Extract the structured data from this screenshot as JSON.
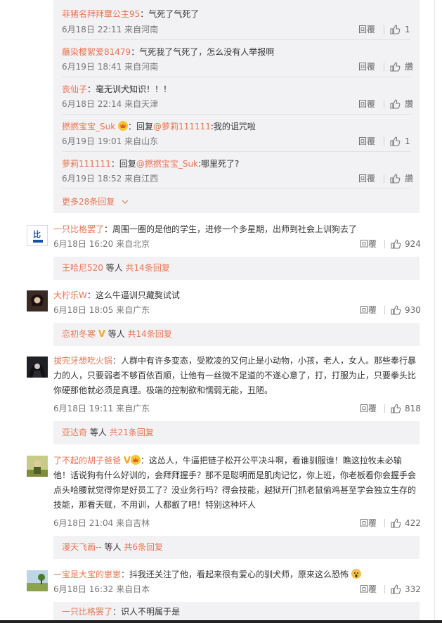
{
  "colors": {
    "accent": "#eb7350",
    "bg_reply": "#f2f2f5",
    "gold": "#f6a623"
  },
  "action_labels": {
    "reply": "回覆"
  },
  "top_replies": [
    {
      "user": "菲猪名拜拜覃公主95",
      "text": "：气死了气死了",
      "time": "6月18日 22:11 来自河南",
      "likes": "1"
    },
    {
      "user": "蘸染樱絮爱81479",
      "text": "：气死我了气死了，怎么没有人举报啊",
      "time": "6月19日 18:41 来自河南",
      "likes": "讚"
    },
    {
      "user": "丧仙子",
      "text": "：毫无训犬知识！！！",
      "time": "6月18日 22:14 来自天津",
      "likes": "讚"
    },
    {
      "user": "撚撚宝宝_Suk",
      "text": "：回复",
      "mention": "@萝莉111111",
      "text2": ":我的诅咒啦",
      "time": "6月19日 19:01 来自山东",
      "likes": "1"
    },
    {
      "user": "萝莉111111",
      "text": "：回复",
      "mention": "@撚撚宝宝_Suk",
      "text2": ":哪里死了?",
      "time": "6月19日 18:52 来自江西",
      "likes": "讚"
    }
  ],
  "more_replies": "更多28条回复",
  "comments": [
    {
      "user": "一只比格罢了",
      "text": "：周围一圈的是他的学生，进修一个多星期，出师到社会上训狗去了",
      "time": "6月18日 16:20 来自北京",
      "likes": "924",
      "sub_user": "王哈尼520",
      "sub_mid": " 等人 ",
      "sub_count": "共14条回复"
    },
    {
      "user": "大柠乐W",
      "text": "：这么牛逼训只藏獒试试",
      "time": "6月18日 18:05 来自广东",
      "likes": "930",
      "sub_user": "恋初冬寒",
      "sub_mid": " 等人 ",
      "sub_count": "共14条回复"
    },
    {
      "user": "拔完牙想吃火锅",
      "lines": [
        "：人群中有许多变态，受欺凌的又何止是小动物，小孩，老人，女人。那些奉行暴",
        "力的人，只要弱者不够百依百顺，让他有一丝微不足道的不遂心意了，打，打服为止，只要拳头比",
        "你硬那他就必须是真理。极端的控制欲和懦弱无能，丑陋。"
      ],
      "time": "6月18日 19:11 来自广东",
      "likes": "818",
      "sub_user": "亚达奇",
      "sub_mid": " 等人 ",
      "sub_count": "共21条回复"
    },
    {
      "user": "了不起的胡子爸爸",
      "lines": [
        "：这怂人，牛逼把链子松开公平决斗啊，看谁驯服谁！瞧这拉牧未必输",
        "他！话说狗有什么好训的，会拜拜握手？那不是聪明而是肌肉记忆，你上班，你老板看你会握手会",
        "点头哈腰就觉得你是好员工了？没业务行吗？得会技能，越狱开门抓老鼠偷鸡甚至学会独立生存的",
        "技能，那看天赋，不用训，人都叡了吧！特别这种坏人"
      ],
      "time": "6月18日 21:04 来自吉林",
      "likes": "422",
      "sub_user": "漫天飞画--",
      "sub_mid": " 等人 ",
      "sub_count": "共6条回复"
    },
    {
      "user": "一宝是大宝的崽崽",
      "text": "：抖我还关注了他，看起来很有爱心的驯犬师，原来这么恐怖",
      "time": "6月18日 16:32 来自日本",
      "likes": "332",
      "sub_user": "一只比格罢了",
      "sub_text": "：识人不明属于是"
    }
  ]
}
